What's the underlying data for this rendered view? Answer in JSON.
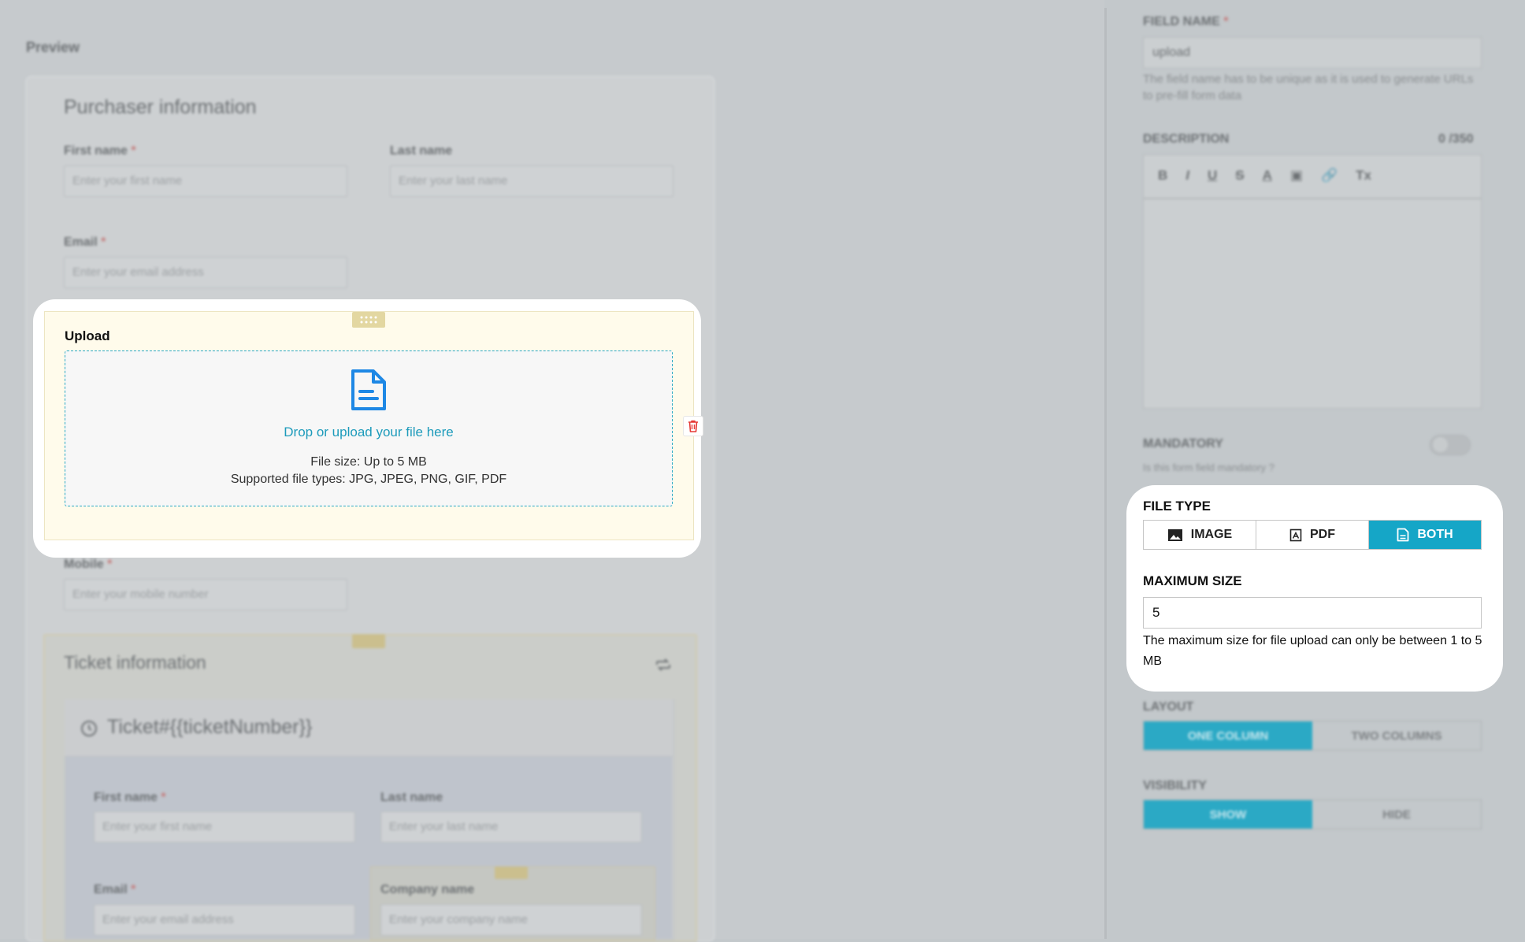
{
  "preview": {
    "label": "Preview",
    "purchaser": {
      "title": "Purchaser information",
      "first_name_label": "First name",
      "first_name_placeholder": "Enter your first name",
      "last_name_label": "Last name",
      "last_name_placeholder": "Enter your last name",
      "email_label": "Email",
      "email_placeholder": "Enter your email address",
      "mobile_label": "Mobile",
      "mobile_placeholder": "Enter your mobile number",
      "required_mark": "*"
    },
    "upload": {
      "label": "Upload",
      "drop_text": "Drop or upload your file here",
      "size_text": "File size: Up to 5 MB",
      "types_text": "Supported file types: JPG, JPEG, PNG, GIF, PDF",
      "icon": "document-icon",
      "delete_icon": "trash-icon"
    },
    "ticket": {
      "title": "Ticket information",
      "ticket_heading": "Ticket#{{ticketNumber}}",
      "first_name_label": "First name",
      "first_name_placeholder": "Enter your first name",
      "last_name_label": "Last name",
      "last_name_placeholder": "Enter your last name",
      "email_label": "Email",
      "email_placeholder": "Enter your email address",
      "company_label": "Company name",
      "company_placeholder": "Enter your company name"
    }
  },
  "settings": {
    "field_name": {
      "label": "FIELD NAME",
      "value": "upload",
      "help": "The field name has to be unique as it is used to generate URLs to pre-fill form data"
    },
    "description": {
      "label": "DESCRIPTION",
      "counter": "0 /350",
      "toolbar": [
        "B",
        "I",
        "U",
        "S",
        "A",
        "▣",
        "🔗",
        "Tx"
      ]
    },
    "mandatory": {
      "label": "MANDATORY",
      "help": "Is this form field mandatory ?",
      "enabled": false
    },
    "file_type": {
      "label": "FILE TYPE",
      "options": [
        {
          "label": "IMAGE",
          "icon": "image-icon"
        },
        {
          "label": "PDF",
          "icon": "pdf-icon"
        },
        {
          "label": "BOTH",
          "icon": "file-icon"
        }
      ],
      "selected": "BOTH"
    },
    "maximum_size": {
      "label": "MAXIMUM SIZE",
      "value": "5",
      "help": "The maximum size for file upload can only be between 1 to 5 MB"
    },
    "layout": {
      "label": "LAYOUT",
      "options": [
        "ONE COLUMN",
        "TWO COLUMNS"
      ],
      "selected": "ONE COLUMN"
    },
    "visibility": {
      "label": "VISIBILITY",
      "options": [
        "SHOW",
        "HIDE"
      ],
      "selected": "SHOW"
    }
  },
  "colors": {
    "accent": "#15a6c7",
    "danger": "#e53935",
    "upload_bg": "#fffbeb"
  }
}
